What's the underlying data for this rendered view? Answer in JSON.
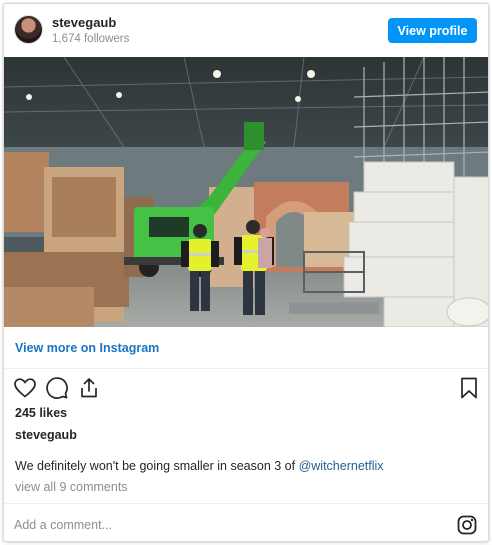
{
  "header": {
    "username": "stevegaub",
    "followers": "1,674 followers",
    "view_profile_label": "View profile"
  },
  "post": {
    "image_icon": "construction-warehouse-photo",
    "view_more_label": "View more on Instagram",
    "likes": "245 likes",
    "owner": "stevegaub",
    "caption_text": "We definitely won't be going smaller in season 3 of ",
    "caption_mention": "@witchernetflix",
    "view_comments": "view all 9 comments"
  },
  "actions": {
    "like_icon": "heart-icon",
    "comment_icon": "comment-icon",
    "share_icon": "share-icon",
    "save_icon": "bookmark-icon"
  },
  "comment_box": {
    "placeholder": "Add a comment...",
    "instagram_icon": "instagram-icon"
  },
  "colors": {
    "accent": "#0095f6",
    "link": "#1b74c5",
    "muted": "#8e8e8e",
    "text": "#262626"
  }
}
